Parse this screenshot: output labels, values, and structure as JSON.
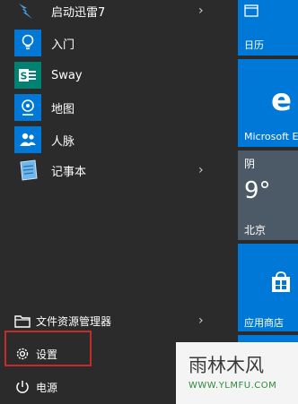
{
  "apps": [
    {
      "label": "启动迅雷7",
      "icon": "thunder-icon",
      "has_submenu": true
    },
    {
      "label": "入门",
      "icon": "lightbulb-icon",
      "has_submenu": false
    },
    {
      "label": "Sway",
      "icon": "sway-icon",
      "has_submenu": false
    },
    {
      "label": "地图",
      "icon": "map-icon",
      "has_submenu": false
    },
    {
      "label": "人脉",
      "icon": "people-icon",
      "has_submenu": false
    },
    {
      "label": "记事本",
      "icon": "notepad-icon",
      "has_submenu": true
    }
  ],
  "chevron": "›",
  "system": {
    "explorer_label": "文件资源管理器",
    "settings_label": "设置",
    "power_label": "电源"
  },
  "tiles": {
    "calendar_label": "日历",
    "edge_label": "Microsoft E",
    "weather_condition": "阴",
    "weather_temp": "9°",
    "weather_city": "北京",
    "store_label": "应用商店"
  },
  "sway_glyph": "S",
  "edge_glyph": "e",
  "watermark": {
    "text": "雨林木风",
    "url": "WWW.YLMFU.COM"
  },
  "colors": {
    "background": "#2b2b2b",
    "tile": "#0078d7",
    "app_icon_bg": "#0078d7",
    "sway_bg": "#008272",
    "highlight": "#c42b2b"
  }
}
